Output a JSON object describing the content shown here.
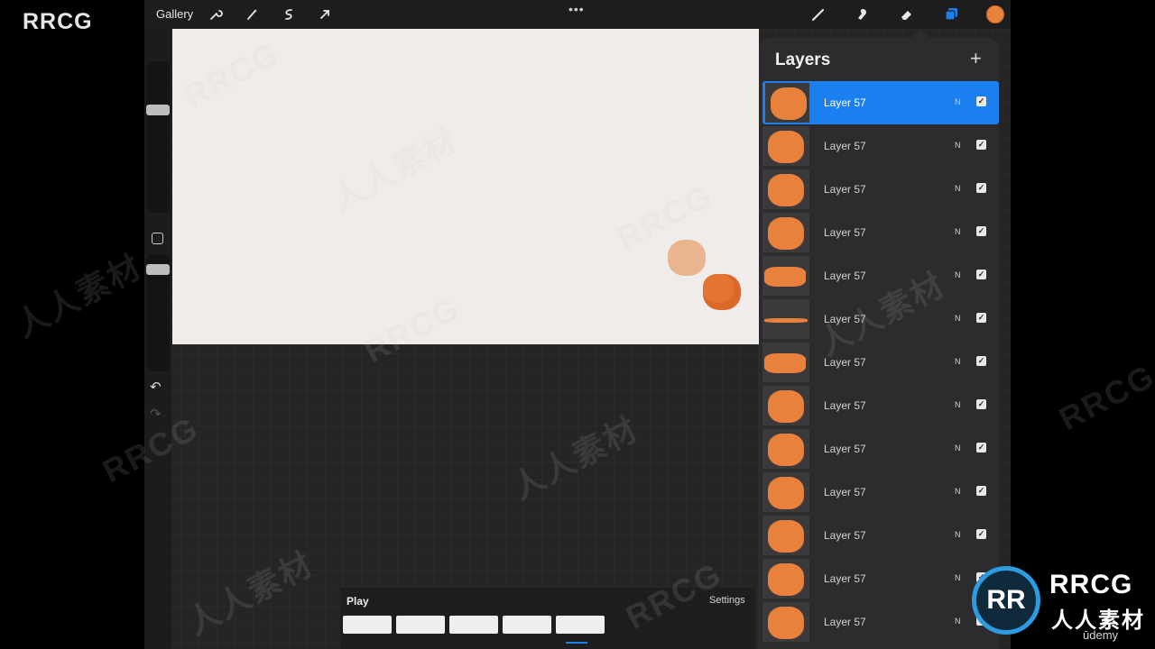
{
  "brand": "RRCG",
  "toolbar": {
    "gallery_label": "Gallery",
    "more_dots": "•••",
    "icons": [
      "wrench-icon",
      "magic-wand-icon",
      "selection-icon",
      "transform-icon",
      "brush-icon",
      "smudge-icon",
      "eraser-icon",
      "layers-icon"
    ],
    "active_color": "#e8813c"
  },
  "canvas": {
    "background": "#efecea",
    "shapes": [
      {
        "name": "onion-skin-circle",
        "color": "#e9b58e"
      },
      {
        "name": "current-circle",
        "color": "#e37432"
      }
    ]
  },
  "sidebar": {
    "undo_icon": "↶",
    "redo_icon": "↷"
  },
  "layers": {
    "title": "Layers",
    "add_icon": "+",
    "accent": "#1c7ff0",
    "items": [
      {
        "label": "Layer 57",
        "blend": "N",
        "visible": true,
        "selected": true
      },
      {
        "label": "Layer 57",
        "blend": "N",
        "visible": true
      },
      {
        "label": "Layer 57",
        "blend": "N",
        "visible": true
      },
      {
        "label": "Layer 57",
        "blend": "N",
        "visible": true
      },
      {
        "label": "Layer 57",
        "blend": "N",
        "visible": true
      },
      {
        "label": "Layer 57",
        "blend": "N",
        "visible": true
      },
      {
        "label": "Layer 57",
        "blend": "N",
        "visible": true
      },
      {
        "label": "Layer 57",
        "blend": "N",
        "visible": true
      },
      {
        "label": "Layer 57",
        "blend": "N",
        "visible": true
      },
      {
        "label": "Layer 57",
        "blend": "N",
        "visible": true
      },
      {
        "label": "Layer 57",
        "blend": "N",
        "visible": true
      },
      {
        "label": "Layer 57",
        "blend": "N",
        "visible": true
      },
      {
        "label": "Layer 57",
        "blend": "N",
        "visible": true
      }
    ]
  },
  "animation": {
    "play_label": "Play",
    "settings_label": "Settings",
    "frame_count": 5
  },
  "watermarks": {
    "latin": "RRCG",
    "cjk": "人人素材"
  },
  "logo": {
    "mark": "RR",
    "title": "RRCG",
    "subtitle": "人人素材"
  },
  "udemy": "ūdemy"
}
